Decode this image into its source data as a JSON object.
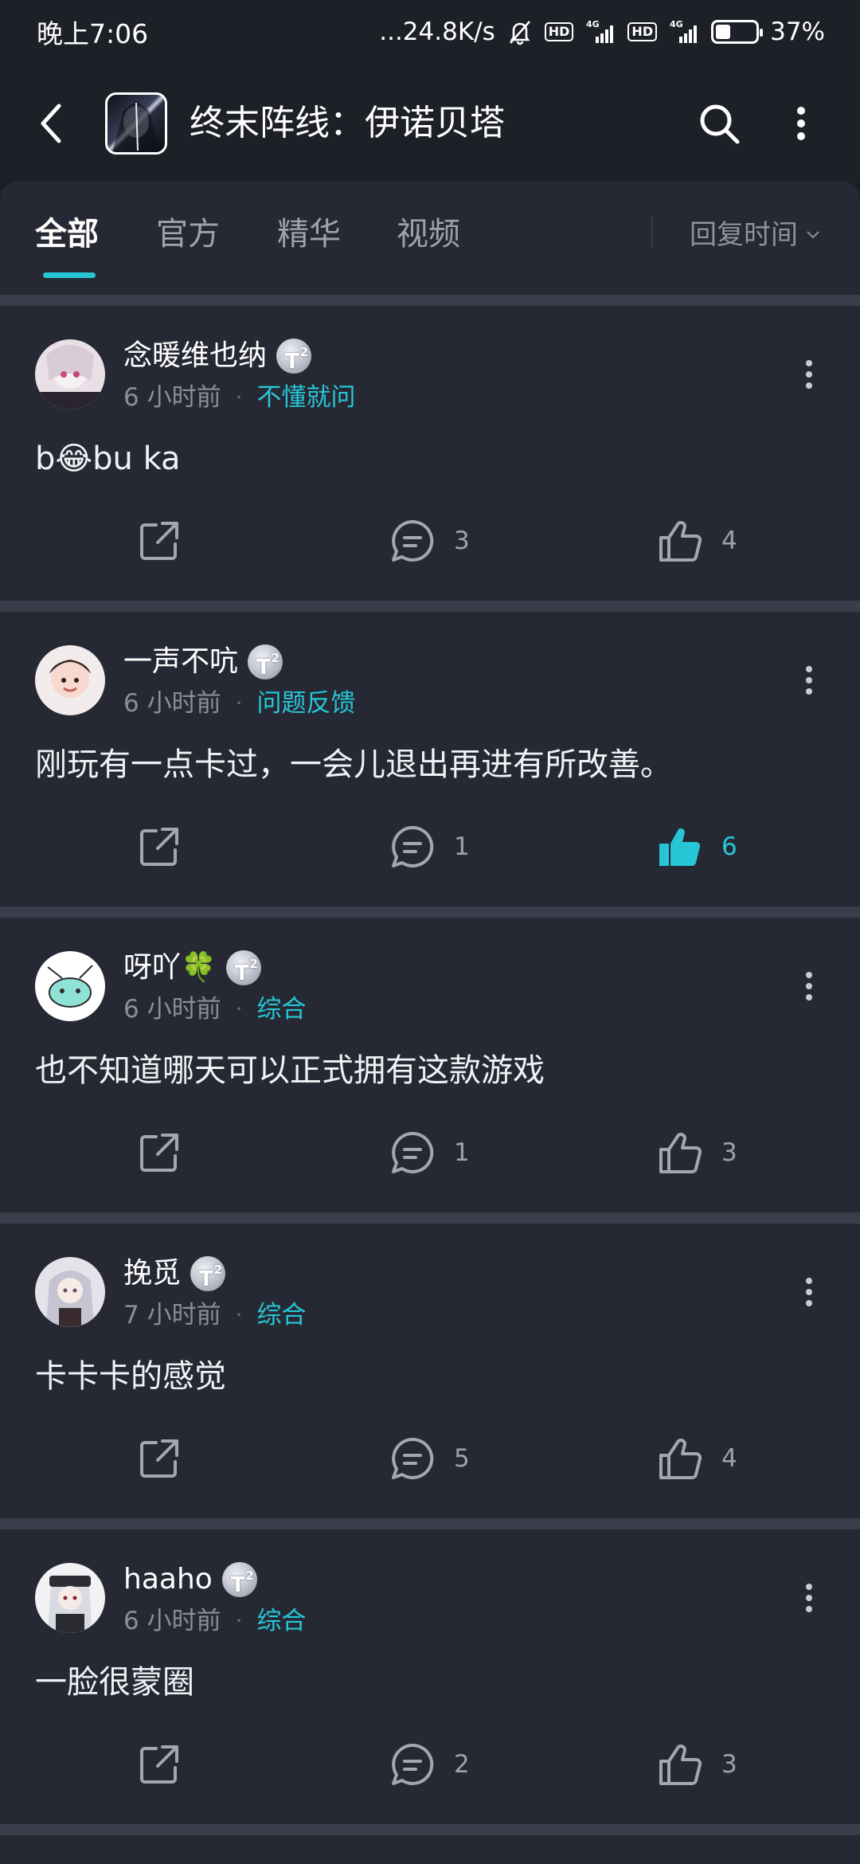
{
  "status_bar": {
    "time": "晚上7:06",
    "speed": "...24.8K/s",
    "hd1": "HD",
    "net1": "4G",
    "hd2": "HD",
    "net2": "4G",
    "battery_percent": 37,
    "battery_text": "37%",
    "icons": [
      "mute-bell-icon",
      "signal-icon",
      "battery-icon"
    ]
  },
  "header": {
    "title": "终末阵线：伊诺贝塔",
    "icons": [
      "back-arrow-icon",
      "game-logo",
      "search-icon",
      "more-vertical-icon"
    ]
  },
  "tabs": [
    {
      "label": "全部",
      "active": true
    },
    {
      "label": "官方",
      "active": false
    },
    {
      "label": "精华",
      "active": false
    },
    {
      "label": "视频",
      "active": false
    }
  ],
  "sort": {
    "label": "回复时间",
    "icon": "chevron-down-icon"
  },
  "colors": {
    "accent": "#27c6d6",
    "background": "#1b1d24",
    "card": "#262934"
  },
  "posts": [
    {
      "username": "念暖维也纳",
      "level": "2",
      "time": "6 小时前",
      "category": "不懂就问",
      "content": "b😂bu  ka",
      "shares": "",
      "comments": "3",
      "likes": "4",
      "liked": false
    },
    {
      "username": "一声不吭",
      "level": "2",
      "time": "6 小时前",
      "category": "问题反馈",
      "content": "刚玩有一点卡过，一会儿退出再进有所改善。",
      "shares": "",
      "comments": "1",
      "likes": "6",
      "liked": true
    },
    {
      "username": "呀吖🍀",
      "level": "2",
      "time": "6 小时前",
      "category": "综合",
      "content": "也不知道哪天可以正式拥有这款游戏",
      "shares": "",
      "comments": "1",
      "likes": "3",
      "liked": false
    },
    {
      "username": "挽觅",
      "level": "2",
      "time": "7 小时前",
      "category": "综合",
      "content": "卡卡卡的感觉",
      "shares": "",
      "comments": "5",
      "likes": "4",
      "liked": false
    },
    {
      "username": "haaho",
      "level": "2",
      "time": "6 小时前",
      "category": "综合",
      "content": "一脸很蒙圈",
      "shares": "",
      "comments": "2",
      "likes": "3",
      "liked": false
    }
  ]
}
